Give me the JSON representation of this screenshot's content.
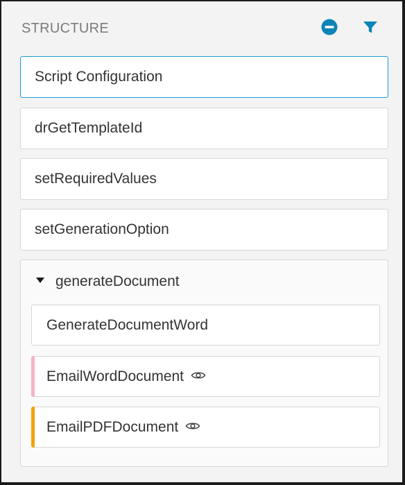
{
  "header": {
    "title": "STRUCTURE",
    "collapse_icon": "minus-circle-icon",
    "filter_icon": "filter-icon",
    "icon_color": "#0b84b7"
  },
  "steps": [
    {
      "label": "Script Configuration",
      "selected": true
    },
    {
      "label": "drGetTemplateId",
      "selected": false
    },
    {
      "label": "setRequiredValues",
      "selected": false
    },
    {
      "label": "setGenerationOption",
      "selected": false
    }
  ],
  "group": {
    "label": "generateDocument",
    "expanded": true,
    "children": [
      {
        "label": "GenerateDocumentWord",
        "accent_color": "",
        "has_eye_icon": false
      },
      {
        "label": "EmailWordDocument",
        "accent_color": "#f6b4c4",
        "has_eye_icon": true,
        "icon": "eye-icon"
      },
      {
        "label": "EmailPDFDocument",
        "accent_color": "#f2a20c",
        "has_eye_icon": true,
        "icon": "eye-icon"
      }
    ]
  },
  "colors": {
    "selected_border": "#1b9bd7"
  }
}
